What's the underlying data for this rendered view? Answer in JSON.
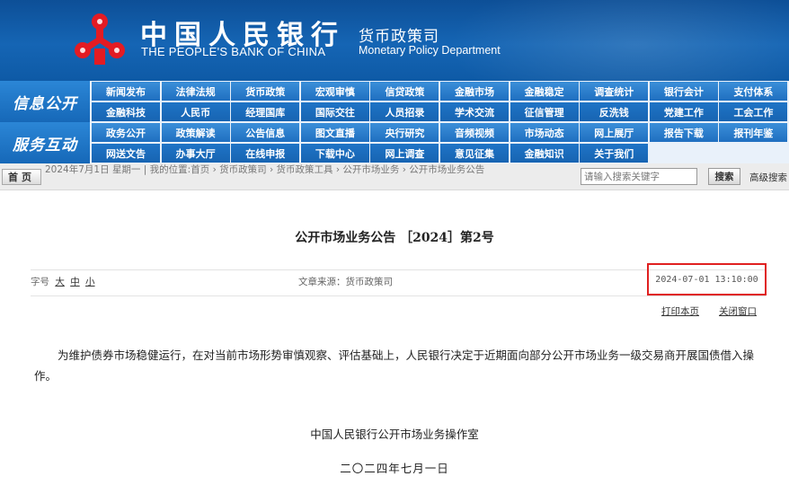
{
  "header": {
    "bank_name_cn": "中国人民银行",
    "bank_name_en": "THE PEOPLE'S BANK OF CHINA",
    "department_cn": "货币政策司",
    "department_en": "Monetary Policy Department"
  },
  "nav": {
    "section1_title": "信息公开",
    "section2_title": "服务互动",
    "rows": [
      [
        "新闻发布",
        "法律法规",
        "货币政策",
        "宏观审慎",
        "信贷政策",
        "金融市场",
        "金融稳定",
        "调查统计",
        "银行会计",
        "支付体系"
      ],
      [
        "金融科技",
        "人民币",
        "经理国库",
        "国际交往",
        "人员招录",
        "学术交流",
        "征信管理",
        "反洗钱",
        "党建工作",
        "工会工作"
      ],
      [
        "政务公开",
        "政策解读",
        "公告信息",
        "图文直播",
        "央行研究",
        "音频视频",
        "市场动态",
        "网上展厅",
        "报告下载",
        "报刊年鉴"
      ],
      [
        "网送文告",
        "办事大厅",
        "在线申报",
        "下载中心",
        "网上调查",
        "意见征集",
        "金融知识",
        "关于我们"
      ]
    ]
  },
  "breadcrumb": {
    "home_button": "首页",
    "date": "2024年7月1日",
    "weekday": "星期一",
    "location_label": "我的位置:",
    "path": [
      "首页",
      "货币政策司",
      "货币政策工具",
      "公开市场业务",
      "公开市场业务公告"
    ]
  },
  "search": {
    "placeholder": "请输入搜索关键字",
    "button": "搜索",
    "advanced": "高级搜索"
  },
  "article": {
    "title": "公开市场业务公告 ［2024］第2号",
    "font_size_label": "字号",
    "font_sizes": [
      "大",
      "中",
      "小"
    ],
    "source": "文章来源：货币政策司",
    "datetime": "2024-07-01 13:10:00",
    "print": "打印本页",
    "close": "关闭窗口",
    "body": "为维护债券市场稳健运行，在对当前市场形势审慎观察、评估基础上，人民银行决定于近期面向部分公开市场业务一级交易商开展国债借入操作。",
    "signature_org": "中国人民银行公开市场业务操作室",
    "signature_date": "二〇二四年七月一日"
  },
  "colors": {
    "banner": "#1565b4",
    "nav_button": "#2a7fd0",
    "highlight_box": "#e02020",
    "logo": "#e31b23"
  }
}
